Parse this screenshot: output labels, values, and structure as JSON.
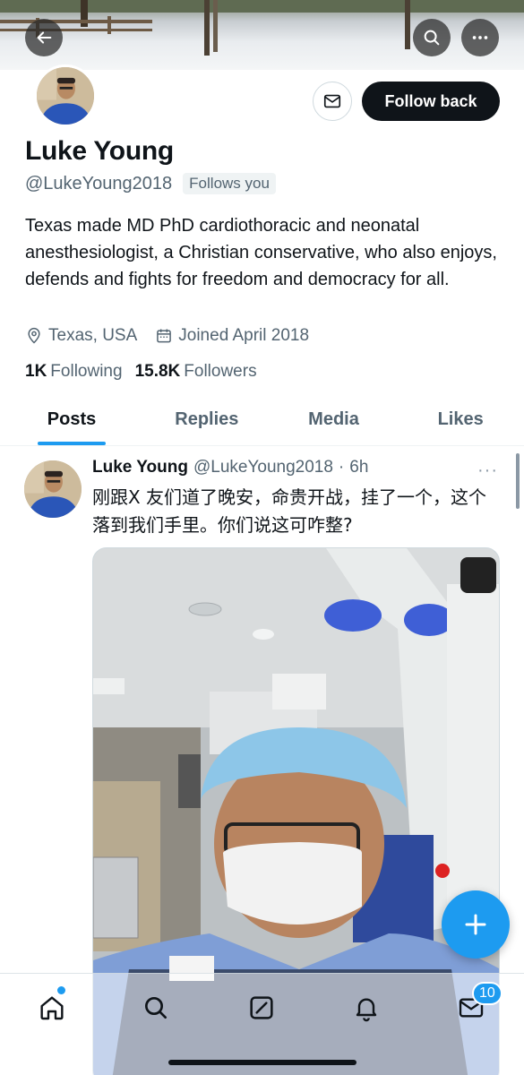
{
  "banner": {
    "back_icon": "arrow-left-icon",
    "search_icon": "search-icon",
    "more_icon": "more-horizontal-icon"
  },
  "profile": {
    "name": "Luke Young",
    "handle": "@LukeYoung2018",
    "follows_you": "Follows you",
    "follow_back_label": "Follow back",
    "message_icon": "mail-icon",
    "bio": "Texas made MD PhD cardiothoracic and neonatal anesthesiologist, a Christian conservative, who also enjoys, defends and fights for freedom and democracy for all.",
    "location": "Texas, USA",
    "joined": "Joined April 2018",
    "following_count": "1K",
    "following_label": "Following",
    "followers_count": "15.8K",
    "followers_label": "Followers"
  },
  "tabs": [
    {
      "label": "Posts",
      "active": true
    },
    {
      "label": "Replies",
      "active": false
    },
    {
      "label": "Media",
      "active": false
    },
    {
      "label": "Likes",
      "active": false
    }
  ],
  "tweet": {
    "name": "Luke Young",
    "handle": "@LukeYoung2018",
    "separator": "·",
    "time": "6h",
    "more": "···",
    "text": "刚跟X 友们道了晚安，命贵开战，挂了一个，这个落到我们手里。你们说这可咋整?"
  },
  "fab": {
    "icon": "plus-icon"
  },
  "bottom_nav": {
    "items": [
      "home-icon",
      "search-icon",
      "grok-icon",
      "notifications-icon",
      "messages-icon"
    ],
    "messages_badge": "10"
  },
  "colors": {
    "accent": "#1d9bf0",
    "text": "#0f1419",
    "secondary": "#536471"
  }
}
